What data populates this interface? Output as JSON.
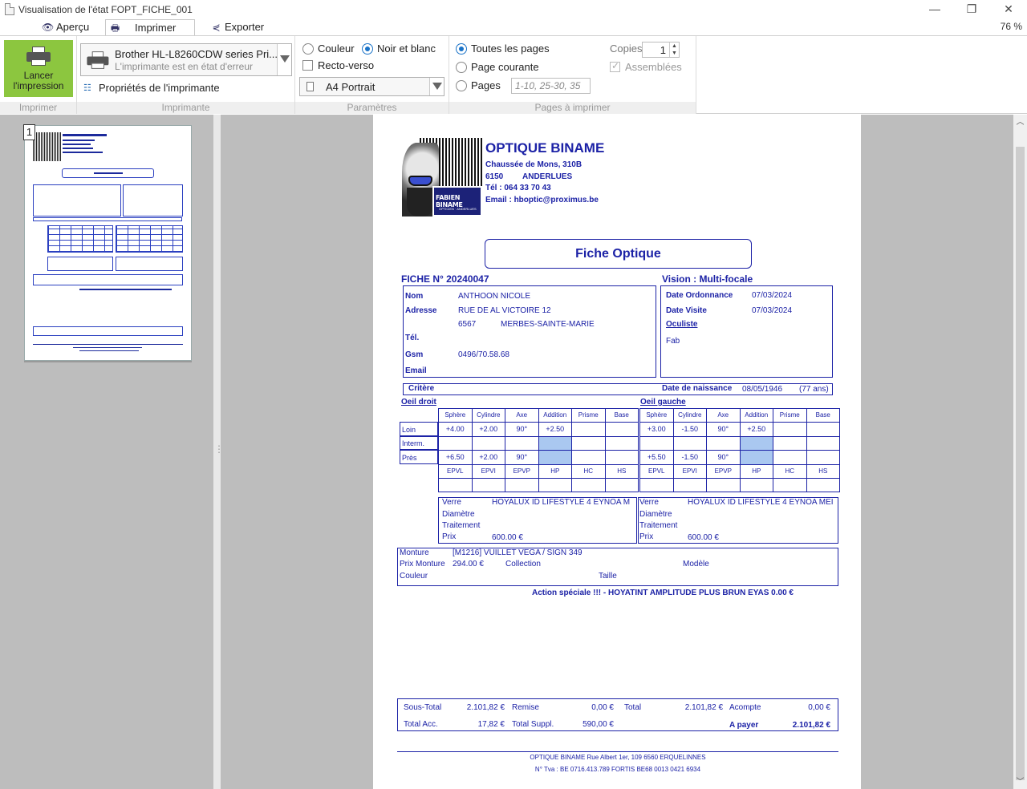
{
  "window": {
    "title": "Visualisation de l'état FOPT_FICHE_001",
    "controls": {
      "minimize": "—",
      "restore": "❐",
      "close": "✕"
    }
  },
  "tabs": [
    {
      "label": "Aperçu",
      "icon": "eye-icon"
    },
    {
      "label": "Imprimer",
      "icon": "printer-icon",
      "active": true
    },
    {
      "label": "Exporter",
      "icon": "share-icon"
    }
  ],
  "zoom": "76 %",
  "ribbon": {
    "print_button": "Lancer l'impression",
    "groups": {
      "print": "Imprimer",
      "printer": "Imprimante",
      "params": "Paramètres",
      "pages": "Pages à imprimer"
    },
    "printer_name": "Brother HL-L8260CDW series Pri...",
    "printer_status": "L'imprimante est en état d'erreur",
    "printer_properties": "Propriétés de l'imprimante",
    "color": "Couleur",
    "bw": "Noir et blanc",
    "duplex": "Recto-verso",
    "paper": "A4 Portrait",
    "all_pages": "Toutes les pages",
    "current_page": "Page courante",
    "pages": "Pages",
    "pages_placeholder": "1-10, 25-30, 35",
    "copies_label": "Copies",
    "copies_value": "1",
    "collate": "Assemblées"
  },
  "thumbnail": {
    "page_number": "1"
  },
  "document": {
    "company": {
      "name": "OPTIQUE BINAME",
      "street": "Chaussée de Mons, 310B",
      "zip": "6150",
      "city": "ANDERLUES",
      "phone": "Tél : 064 33 70 43",
      "email": "Email : hboptic@proximus.be",
      "logo_text": "FABIEN BINAME",
      "logo_sub": "OPTICIEN · ANDERLUES"
    },
    "title": "Fiche Optique",
    "fiche_no": "FICHE N° 20240047",
    "vision": "Vision : Multi-focale",
    "client": {
      "nom_label": "Nom",
      "nom": "ANTHOON NICOLE",
      "adresse_label": "Adresse",
      "adresse": "RUE DE AL VICTOIRE 12",
      "zip": "6567",
      "city": "MERBES-SAINTE-MARIE",
      "tel_label": "Tél.",
      "gsm_label": "Gsm",
      "gsm": "0496/70.58.68",
      "email_label": "Email"
    },
    "dates": {
      "ordonnance_label": "Date Ordonnance",
      "ordonnance": "07/03/2024",
      "visite_label": "Date Visite",
      "visite": "07/03/2024",
      "oculiste_label": "Oculiste",
      "oculiste": "Fab"
    },
    "critere_label": "Critère",
    "naissance_label": "Date de naissance",
    "naissance": "08/05/1946",
    "age": "(77 ans)",
    "od_label": "Oeil droit",
    "og_label": "Oeil gauche",
    "row_labels": [
      "Loin",
      "Interm.",
      "Près"
    ],
    "headers": [
      "Sphère",
      "Cylindre",
      "Axe",
      "Addition",
      "Prisme",
      "Base"
    ],
    "headers2": [
      "EPVL",
      "EPVI",
      "EPVP",
      "HP",
      "HC",
      "HS"
    ],
    "od": {
      "loin": [
        "+4.00",
        "+2.00",
        "90°",
        "+2.50",
        "",
        ""
      ],
      "inter": [
        "",
        "",
        "",
        "",
        "",
        ""
      ],
      "pres": [
        "+6.50",
        "+2.00",
        "90°",
        "",
        "",
        ""
      ]
    },
    "og": {
      "loin": [
        "+3.00",
        "-1.50",
        "90°",
        "+2.50",
        "",
        ""
      ],
      "inter": [
        "",
        "",
        "",
        "",
        "",
        ""
      ],
      "pres": [
        "+5.50",
        "-1.50",
        "90°",
        "",
        "",
        ""
      ]
    },
    "verre_left": {
      "verre_label": "Verre",
      "verre": "HOYALUX ID LIFESTYLE 4 EYNOA M",
      "diam_label": "Diamètre",
      "trait_label": "Traitement",
      "prix_label": "Prix",
      "prix": "600.00 €"
    },
    "verre_right": {
      "verre_label": "Verre",
      "verre": "HOYALUX ID LIFESTYLE 4 EYNOA MEI",
      "diam_label": "Diamètre",
      "trait_label": "Traitement",
      "prix_label": "Prix",
      "prix": "600.00 €"
    },
    "monture": {
      "label": "Monture",
      "value": "[M1216] VUILLET VEGA / SIGN 349",
      "prix_label": "Prix Monture",
      "prix": "294.00 €",
      "collection_label": "Collection",
      "modele_label": "Modèle",
      "couleur_label": "Couleur",
      "taille_label": "Taille"
    },
    "action": "Action spéciale !!! - HOYATINT AMPLITUDE PLUS BRUN EYAS  0.00 €",
    "totals": {
      "sous_total_label": "Sous-Total",
      "sous_total": "2.101,82 €",
      "remise_label": "Remise",
      "remise": "0,00 €",
      "total_label": "Total",
      "total": "2.101,82 €",
      "acompte_label": "Acompte",
      "acompte": "0,00 €",
      "total_acc_label": "Total Acc.",
      "total_acc": "17,82 €",
      "total_suppl_label": "Total Suppl.",
      "total_suppl": "590,00 €",
      "apayer_label": "A payer",
      "apayer": "2.101,82 €"
    },
    "footer1": "OPTIQUE BINAME   Rue Albert 1er, 109   6560   ERQUELINNES",
    "footer2": "N° Tva : BE 0716.413.789    FORTIS    BE68 0013 0421 6934"
  }
}
